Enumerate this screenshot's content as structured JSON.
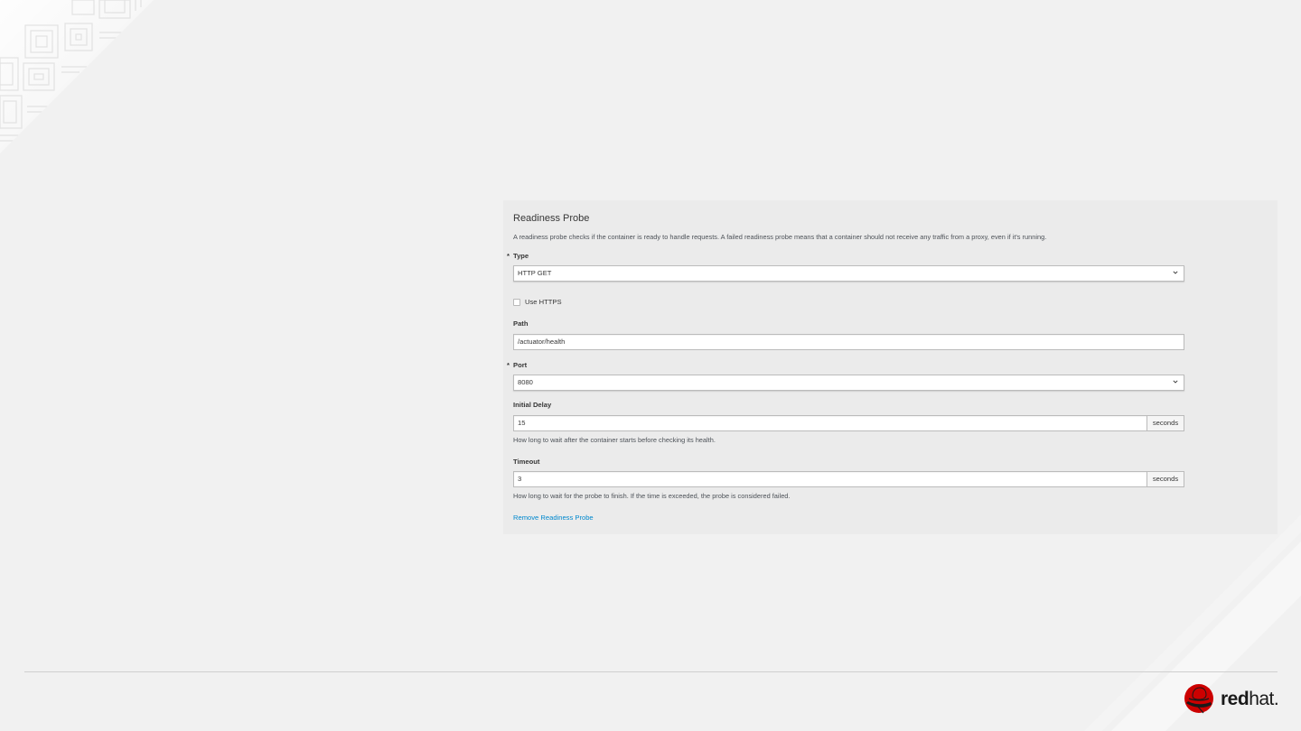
{
  "colors": {
    "background": "#f1f1f1",
    "panel": "#ebebeb",
    "link": "#0088ce",
    "brand_red": "#cc0000"
  },
  "panel": {
    "title": "Readiness Probe",
    "description": "A readiness probe checks if the container is ready to handle requests. A failed readiness probe means that a container should not receive any traffic from a proxy, even if it's running.",
    "type": {
      "required_mark": "*",
      "label": "Type",
      "value": "HTTP GET",
      "icon": "chevron-down-icon"
    },
    "use_https": {
      "label": "Use HTTPS",
      "checked": false
    },
    "path": {
      "label": "Path",
      "value": "/actuator/health"
    },
    "port": {
      "required_mark": "*",
      "label": "Port",
      "value": "8080",
      "icon": "chevron-down-icon"
    },
    "initial_delay": {
      "label": "Initial Delay",
      "value": "15",
      "unit": "seconds",
      "help": "How long to wait after the container starts before checking its health."
    },
    "timeout": {
      "label": "Timeout",
      "value": "3",
      "unit": "seconds",
      "help": "How long to wait for the probe to finish. If the time is exceeded, the probe is considered failed."
    },
    "remove_link": "Remove Readiness Probe"
  },
  "footer": {
    "logo_text_bold": "red",
    "logo_text_light": "hat.",
    "logo_icon": "redhat-shadowman-icon"
  }
}
